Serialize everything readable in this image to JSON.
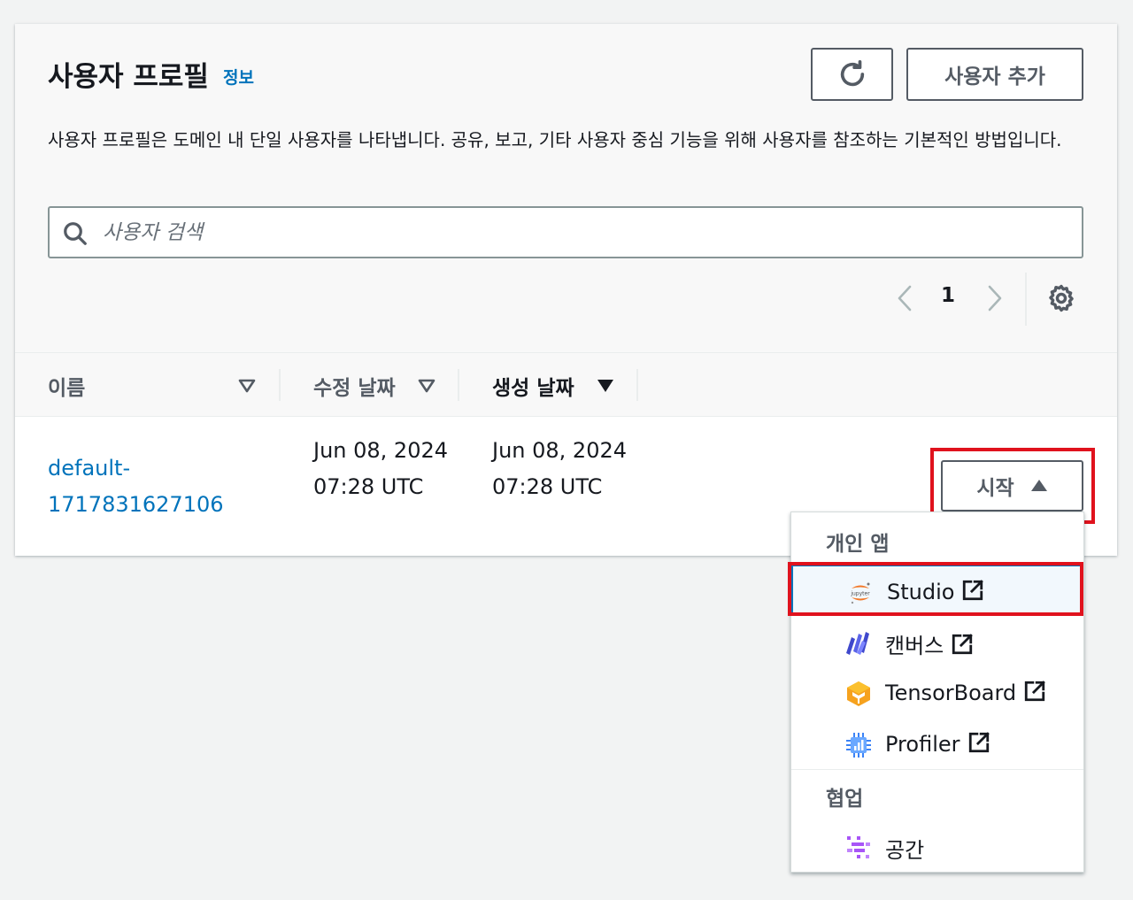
{
  "header": {
    "title": "사용자 프로필",
    "info_link": "정보",
    "add_user_label": "사용자 추가",
    "description": "사용자 프로필은 도메인 내 단일 사용자를 나타냅니다. 공유, 보고, 기타 사용자 중심 기능을 위해 사용자를 참조하는 기본적인 방법입니다."
  },
  "search": {
    "placeholder": "사용자 검색"
  },
  "pagination": {
    "current_page": "1"
  },
  "table": {
    "columns": [
      {
        "label": "이름",
        "sort": "none"
      },
      {
        "label": "수정 날짜",
        "sort": "none"
      },
      {
        "label": "생성 날짜",
        "sort": "descending"
      }
    ],
    "rows": [
      {
        "name": "default-1717831627106",
        "modified": "Jun 08, 2024 07:28 UTC",
        "created": "Jun 08, 2024 07:28 UTC"
      }
    ]
  },
  "start_button": {
    "label": "시작"
  },
  "launch_menu": {
    "groups": [
      {
        "label": "개인 앱",
        "items": [
          {
            "label": "Studio",
            "icon": "jupyter-icon",
            "external": true
          },
          {
            "label": "캔버스",
            "icon": "canvas-icon",
            "external": true
          },
          {
            "label": "TensorBoard",
            "icon": "tensorboard-icon",
            "external": true
          },
          {
            "label": "Profiler",
            "icon": "profiler-icon",
            "external": true
          }
        ]
      },
      {
        "label": "협업",
        "items": [
          {
            "label": "공간",
            "icon": "spaces-icon",
            "external": false
          }
        ]
      }
    ]
  },
  "colors": {
    "link": "#0073bb",
    "highlight": "#e0121d",
    "border": "#545b64"
  }
}
